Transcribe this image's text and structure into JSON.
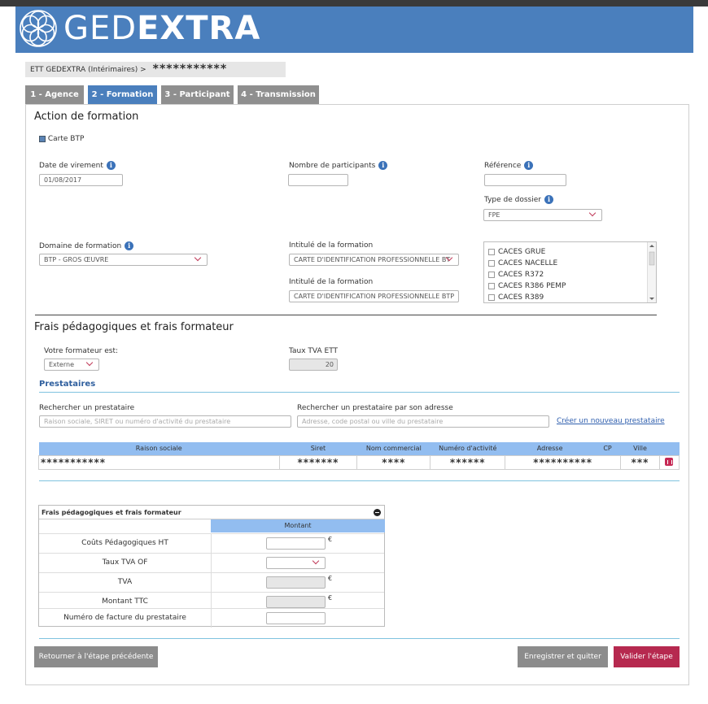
{
  "brand": {
    "light": "GED",
    "bold": "EXTRA",
    "color": "#4a7fbd"
  },
  "breadcrumb": {
    "prefix": "ETT GEDEXTRA (Intérimaires) >",
    "masked": "***********"
  },
  "tabs": [
    {
      "label": "1 - Agence",
      "active": false
    },
    {
      "label": "2 - Formation",
      "active": true
    },
    {
      "label": "3 - Participant",
      "active": false
    },
    {
      "label": "4 - Transmission",
      "active": false
    }
  ],
  "action": {
    "title": "Action de formation",
    "carte_btp": {
      "label": "Carte BTP",
      "checked": true
    },
    "date_virement": {
      "label": "Date de virement",
      "value": "01/08/2017"
    },
    "nb_participants": {
      "label": "Nombre de participants",
      "value": ""
    },
    "reference": {
      "label": "Référence",
      "value": ""
    },
    "type_dossier": {
      "label": "Type de dossier",
      "value": "FPE"
    },
    "domaine": {
      "label": "Domaine de formation",
      "value": "BTP - GROS ŒUVRE"
    },
    "intitule1": {
      "label": "Intitulé de la formation",
      "value": "CARTE D'IDENTIFICATION PROFESSIONNELLE BT"
    },
    "intitule2": {
      "label": "Intitulé de la formation",
      "value": "CARTE D'IDENTIFICATION PROFESSIONNELLE BTP"
    },
    "list_items": [
      "CACES GRUE",
      "CACES NACELLE",
      "CACES R372",
      "CACES R386 PEMP",
      "CACES R389"
    ]
  },
  "frais": {
    "title": "Frais pédagogiques et frais formateur",
    "formateur": {
      "label": "Votre formateur est:",
      "value": "Externe"
    },
    "taux_tva_ett": {
      "label": "Taux TVA ETT",
      "value": "20"
    },
    "prestataires_title": "Prestataires",
    "search1": {
      "label": "Rechercher un prestataire",
      "placeholder": "Raison sociale, SIRET ou numéro d'activité du prestataire"
    },
    "search2": {
      "label": "Rechercher un prestataire par son adresse",
      "placeholder": "Adresse, code postal ou ville du prestataire"
    },
    "create_link": "Créer un nouveau prestataire",
    "table": {
      "headers": [
        "Raison sociale",
        "Siret",
        "Nom commercial",
        "Numéro d'activité",
        "Adresse",
        "CP",
        "Ville"
      ],
      "row": [
        "***********",
        "*******",
        "****",
        "******",
        "**********",
        "",
        "***"
      ]
    }
  },
  "fbox": {
    "title": "Frais pédagogiques et frais formateur",
    "col": "Montant",
    "rows": [
      {
        "label": "Coûts Pédagogiques HT",
        "unit": "€"
      },
      {
        "label": "Taux TVA OF",
        "unit": ""
      },
      {
        "label": "TVA",
        "unit": "€"
      },
      {
        "label": "Montant TTC",
        "unit": "€"
      },
      {
        "label": "Numéro de facture du prestataire",
        "unit": ""
      }
    ]
  },
  "buttons": {
    "back": "Retourner à l'étape précédente",
    "save": "Enregistrer et quitter",
    "validate": "Valider l'étape"
  }
}
